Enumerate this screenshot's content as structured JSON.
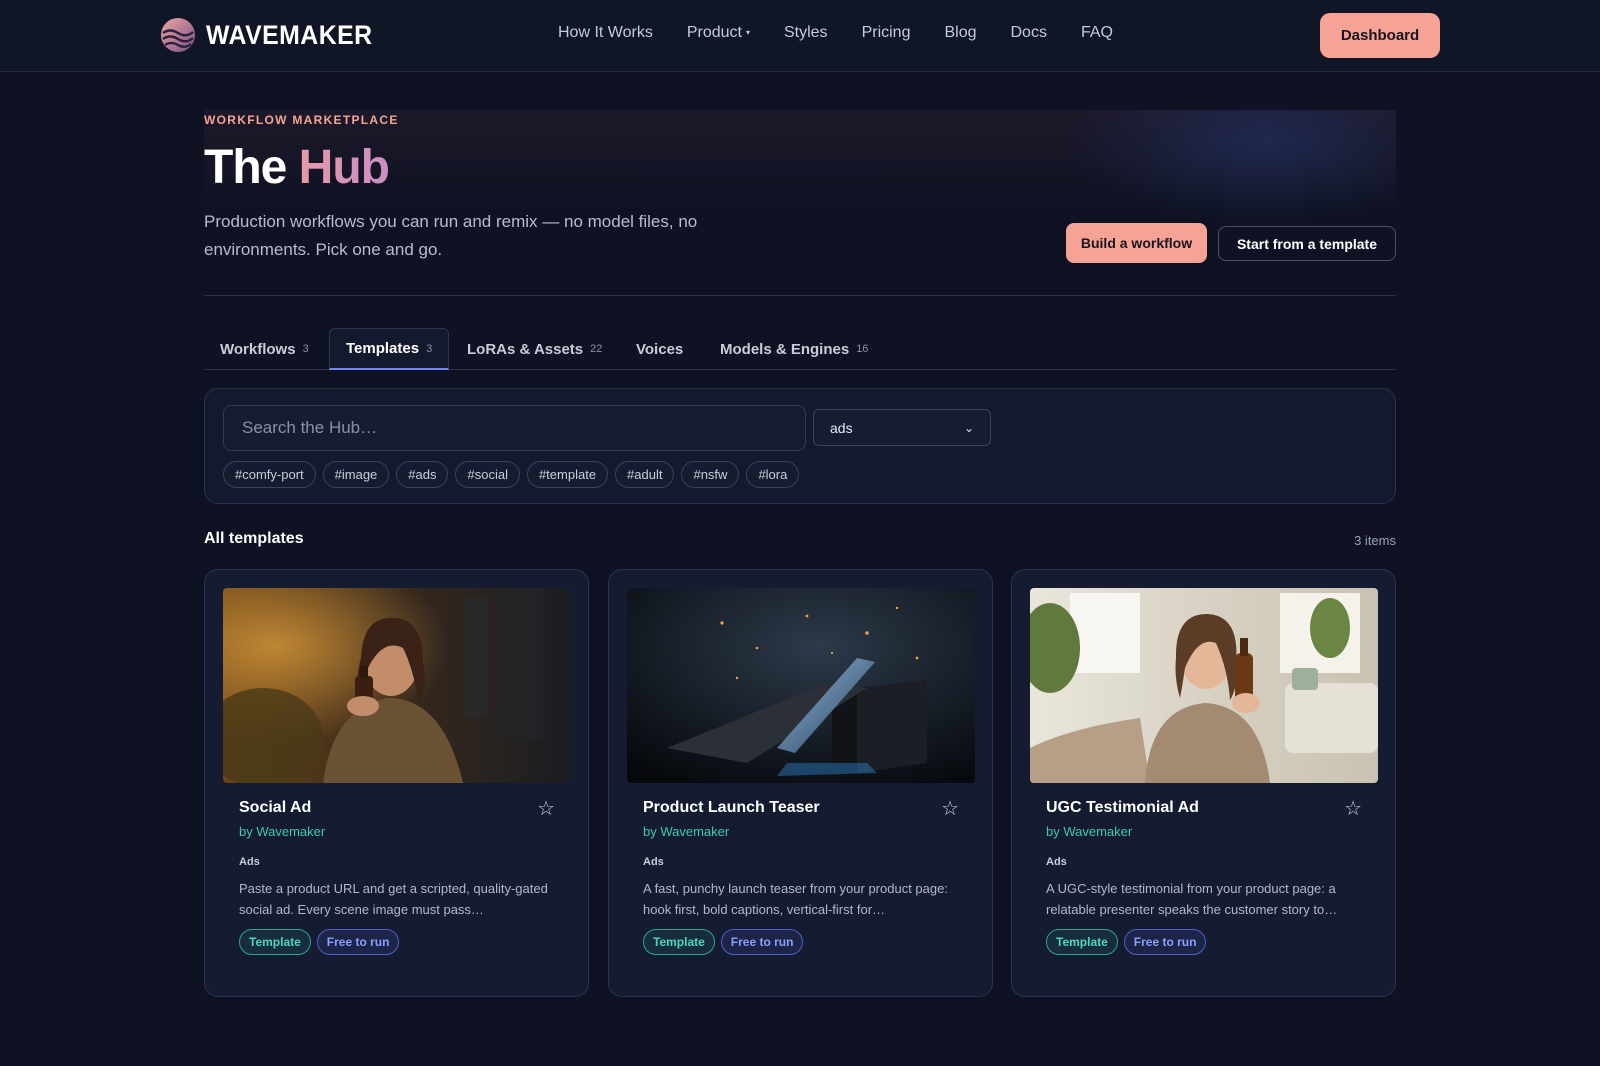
{
  "nav": {
    "brand": "WAVEMAKER",
    "links": [
      "How It Works",
      "Product",
      "Styles",
      "Pricing",
      "Blog",
      "Docs",
      "FAQ"
    ],
    "product_caret": "▾",
    "dashboard": "Dashboard"
  },
  "hero": {
    "eyebrow": "WORKFLOW MARKETPLACE",
    "title_a": "The ",
    "title_b": "Hub",
    "description": "Production workflows you can run and remix — no model files, no environments. Pick one and go.",
    "build_button": "Build a workflow",
    "template_button": "Start from a template"
  },
  "tabs": [
    {
      "label": "Workflows",
      "count": "3"
    },
    {
      "label": "Templates",
      "count": "3",
      "active": true
    },
    {
      "label": "LoRAs & Assets",
      "count": "22"
    },
    {
      "label": "Voices",
      "count": ""
    },
    {
      "label": "Models & Engines",
      "count": "16"
    }
  ],
  "filter": {
    "search_placeholder": "Search the Hub…",
    "select_value": "ads",
    "tags": [
      "#comfy-port",
      "#image",
      "#ads",
      "#social",
      "#template",
      "#adult",
      "#nsfw",
      "#lora"
    ]
  },
  "section": {
    "title": "All templates",
    "count": "3 items"
  },
  "cards": [
    {
      "title": "Social Ad",
      "author": "by Wavemaker",
      "category": "Ads",
      "description": "Paste a product URL and get a scripted, quality-gated social ad. Every scene image must pass…",
      "badge_template": "Template",
      "badge_free": "Free to run",
      "star": "☆",
      "image_icon": "photo-woman-holding-bottle"
    },
    {
      "title": "Product Launch Teaser",
      "author": "by Wavemaker",
      "category": "Ads",
      "description": "A fast, punchy launch teaser from your product page: hook first, bold captions, vertical-first for…",
      "badge_template": "Template",
      "badge_free": "Free to run",
      "star": "☆",
      "image_icon": "photo-product-device"
    },
    {
      "title": "UGC Testimonial Ad",
      "author": "by Wavemaker",
      "category": "Ads",
      "description": "A UGC-style testimonial from your product page: a relatable presenter speaks the customer story to…",
      "badge_template": "Template",
      "badge_free": "Free to run",
      "star": "☆",
      "image_icon": "photo-selfie-woman-bottle"
    }
  ],
  "colors": {
    "background": "#0e1222",
    "accent": "#f4a394",
    "author": "#3cc8b4",
    "tab_underline": "#6e86ff"
  }
}
